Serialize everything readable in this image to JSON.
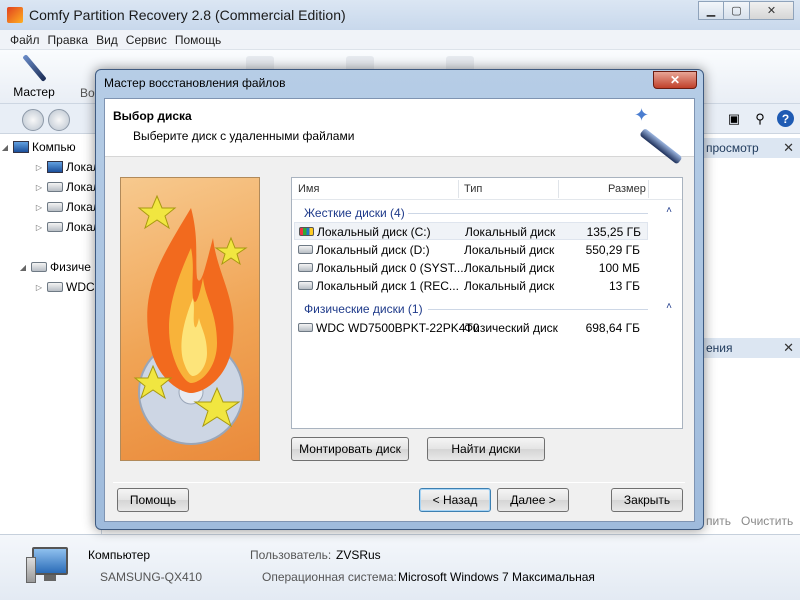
{
  "app": {
    "title": "Comfy Partition Recovery 2.8 (Commercial Edition)"
  },
  "menu": [
    "Файл",
    "Правка",
    "Вид",
    "Сервис",
    "Помощь"
  ],
  "toolbar": {
    "master_label": "Мастер",
    "partial_label": "Во"
  },
  "tree": {
    "computer": "Компью",
    "local_items": [
      "Локал",
      "Локал",
      "Локал",
      "Локал"
    ],
    "physical": "Физиче",
    "wdc": "WDC"
  },
  "right_pane": {
    "preview_label": "просмотр",
    "second_label": "ения",
    "action1": "пить",
    "action2": "Очистить"
  },
  "status": {
    "computer_label": "Компьютер",
    "computer_name": "SAMSUNG-QX410",
    "user_label": "Пользователь:",
    "user_value": "ZVSRus",
    "os_label": "Операционная система:",
    "os_value": "Microsoft Windows 7 Максимальная"
  },
  "wizard": {
    "title": "Мастер восстановления файлов",
    "close_glyph": "✕",
    "heading": "Выбор диска",
    "subheading": "Выберите диск с удаленными файлами",
    "columns": {
      "name": "Имя",
      "type": "Тип",
      "size": "Размер"
    },
    "groups": [
      {
        "label": "Жесткие диски (4)",
        "rows": [
          {
            "name": "Локальный диск (C:)",
            "type": "Локальный диск",
            "size": "135,25 ГБ",
            "icon": "windows-drive-icon"
          },
          {
            "name": "Локальный диск (D:)",
            "type": "Локальный диск",
            "size": "550,29 ГБ",
            "icon": "drive-icon"
          },
          {
            "name": "Локальный диск 0 (SYST...",
            "type": "Локальный диск",
            "size": "100 МБ",
            "icon": "drive-icon"
          },
          {
            "name": "Локальный диск 1 (REC...",
            "type": "Локальный диск",
            "size": "13 ГБ",
            "icon": "drive-icon"
          }
        ]
      },
      {
        "label": "Физические диски (1)",
        "rows": [
          {
            "name": "WDC WD7500BPKT-22PK4T0",
            "type": "Физический диск",
            "size": "698,64 ГБ",
            "icon": "drive-icon"
          }
        ]
      }
    ],
    "buttons": {
      "mount": "Монтировать диск",
      "find": "Найти диски",
      "help": "Помощь",
      "back": "< Назад",
      "next": "Далее >",
      "close": "Закрыть"
    }
  }
}
